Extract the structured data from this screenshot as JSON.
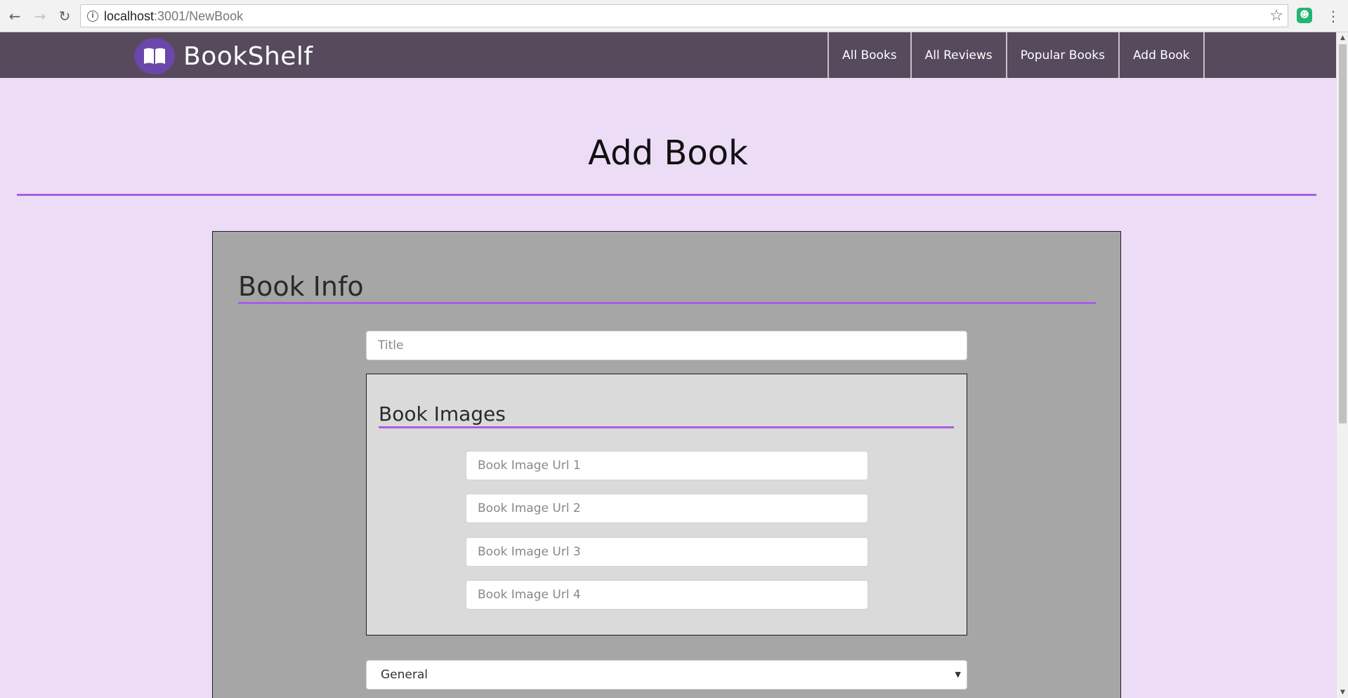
{
  "browser": {
    "url_host": "localhost",
    "url_path": ":3001/NewBook",
    "back_icon": "arrow-left-icon",
    "forward_icon": "arrow-right-icon",
    "reload_icon": "reload-icon",
    "info_icon": "info-icon",
    "star_icon": "star-icon",
    "extension_icon": "extension-icon",
    "menu_icon": "more-vert-icon"
  },
  "navbar": {
    "brand": "BookShelf",
    "logo_icon": "open-book-icon",
    "links": [
      {
        "label": "All Books"
      },
      {
        "label": "All Reviews"
      },
      {
        "label": "Popular Books"
      },
      {
        "label": "Add Book"
      }
    ]
  },
  "page": {
    "title": "Add Book"
  },
  "form": {
    "section_title": "Book Info",
    "title_placeholder": "Title",
    "title_value": "",
    "images_title": "Book Images",
    "image_fields": [
      {
        "placeholder": "Book Image Url 1",
        "value": ""
      },
      {
        "placeholder": "Book Image Url 2",
        "value": ""
      },
      {
        "placeholder": "Book Image Url 3",
        "value": ""
      },
      {
        "placeholder": "Book Image Url 4",
        "value": ""
      }
    ],
    "genre_selected": "General"
  },
  "colors": {
    "accent": "#a561e0",
    "navbar_bg": "#564a5c",
    "page_bg": "#ecdcf6",
    "panel_bg": "#a6a6a6",
    "images_box_bg": "#dadada"
  }
}
